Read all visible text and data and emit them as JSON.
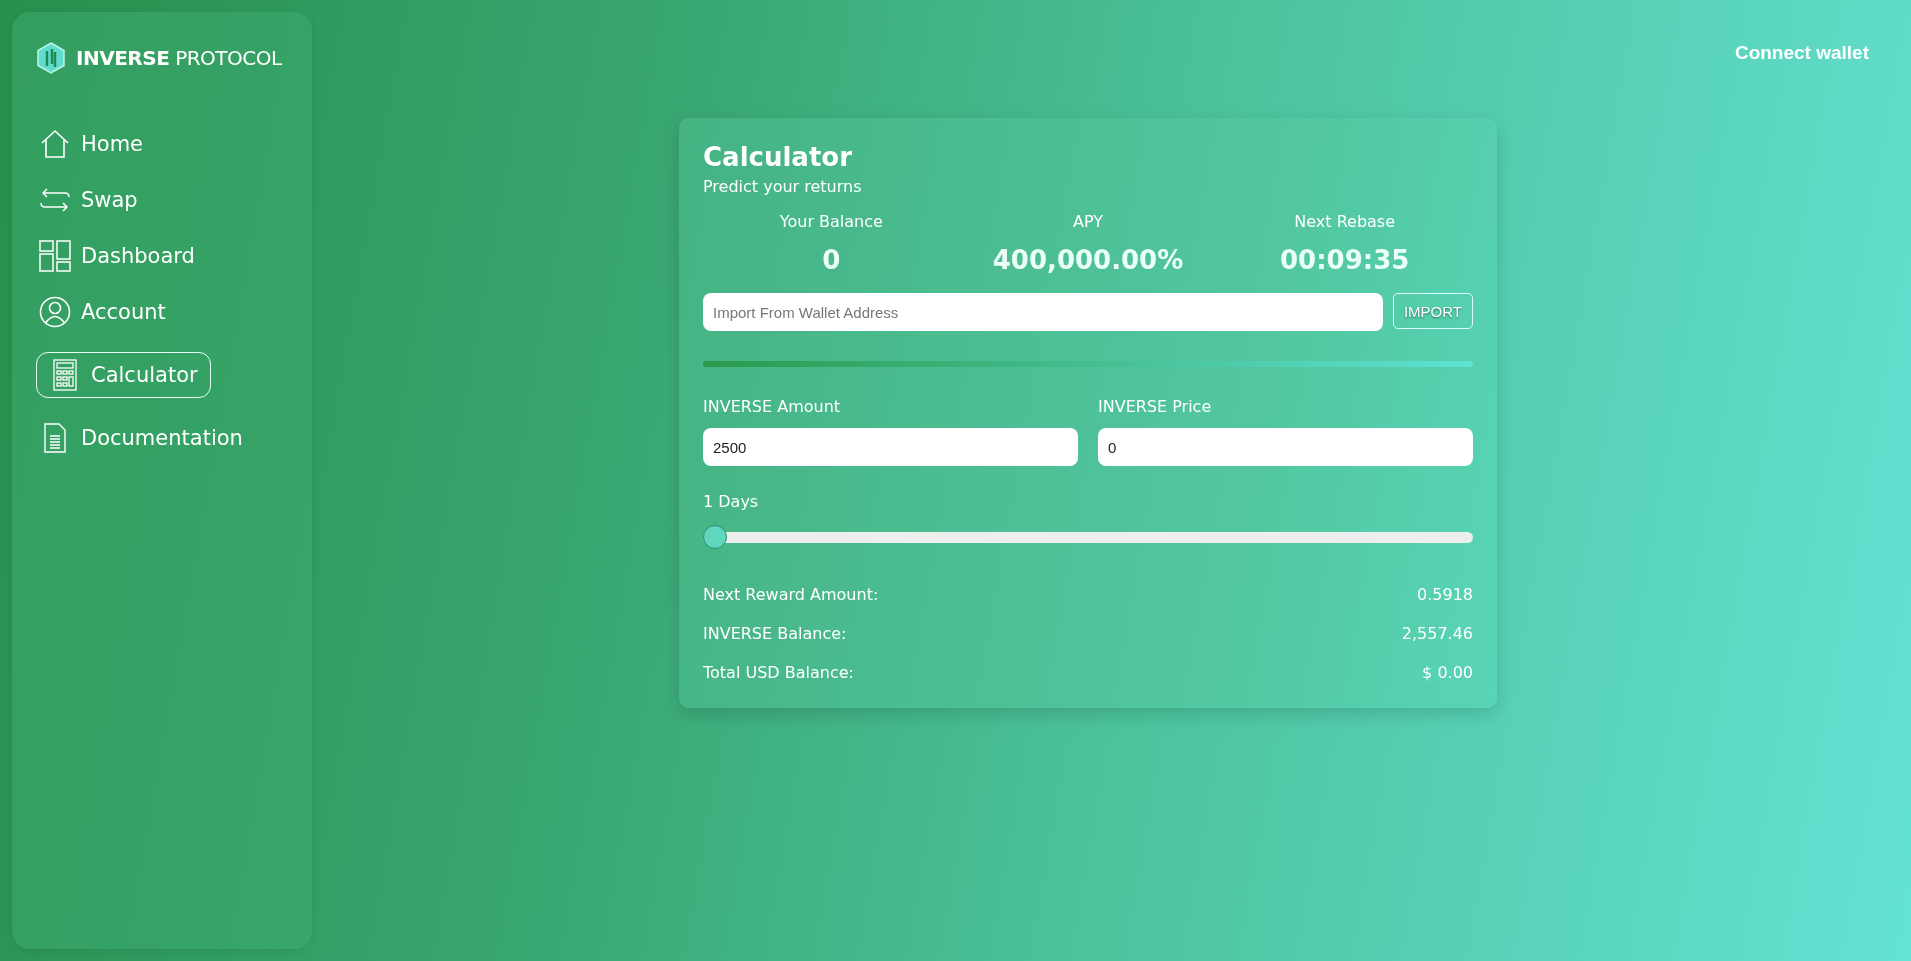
{
  "brand": {
    "name_bold": "INVERSE",
    "name_light": "PROTOCOL"
  },
  "nav": [
    {
      "label": "Home",
      "selected": false
    },
    {
      "label": "Swap",
      "selected": false
    },
    {
      "label": "Dashboard",
      "selected": false
    },
    {
      "label": "Account",
      "selected": false
    },
    {
      "label": "Calculator",
      "selected": true
    },
    {
      "label": "Documentation",
      "selected": false
    }
  ],
  "header": {
    "connect_button": "Connect wallet"
  },
  "calculator": {
    "title": "Calculator",
    "subtitle": "Predict your returns",
    "stats": [
      {
        "label": "Your Balance",
        "value": "0"
      },
      {
        "label": "APY",
        "value": "400,000.00%"
      },
      {
        "label": "Next Rebase",
        "value": "00:09:35"
      }
    ],
    "import": {
      "placeholder": "Import From Wallet Address",
      "button": "IMPORT"
    },
    "fields": [
      {
        "label": "INVERSE Amount",
        "value": "2500"
      },
      {
        "label": "INVERSE Price",
        "value": "0"
      }
    ],
    "days": {
      "label": "1 Days",
      "level": 0
    },
    "results": [
      {
        "label": "Next Reward Amount:",
        "value": "0.5918"
      },
      {
        "label": "INVERSE Balance:",
        "value": "2,557.46"
      },
      {
        "label": "Total USD Balance:",
        "value": "$ 0.00"
      }
    ]
  }
}
